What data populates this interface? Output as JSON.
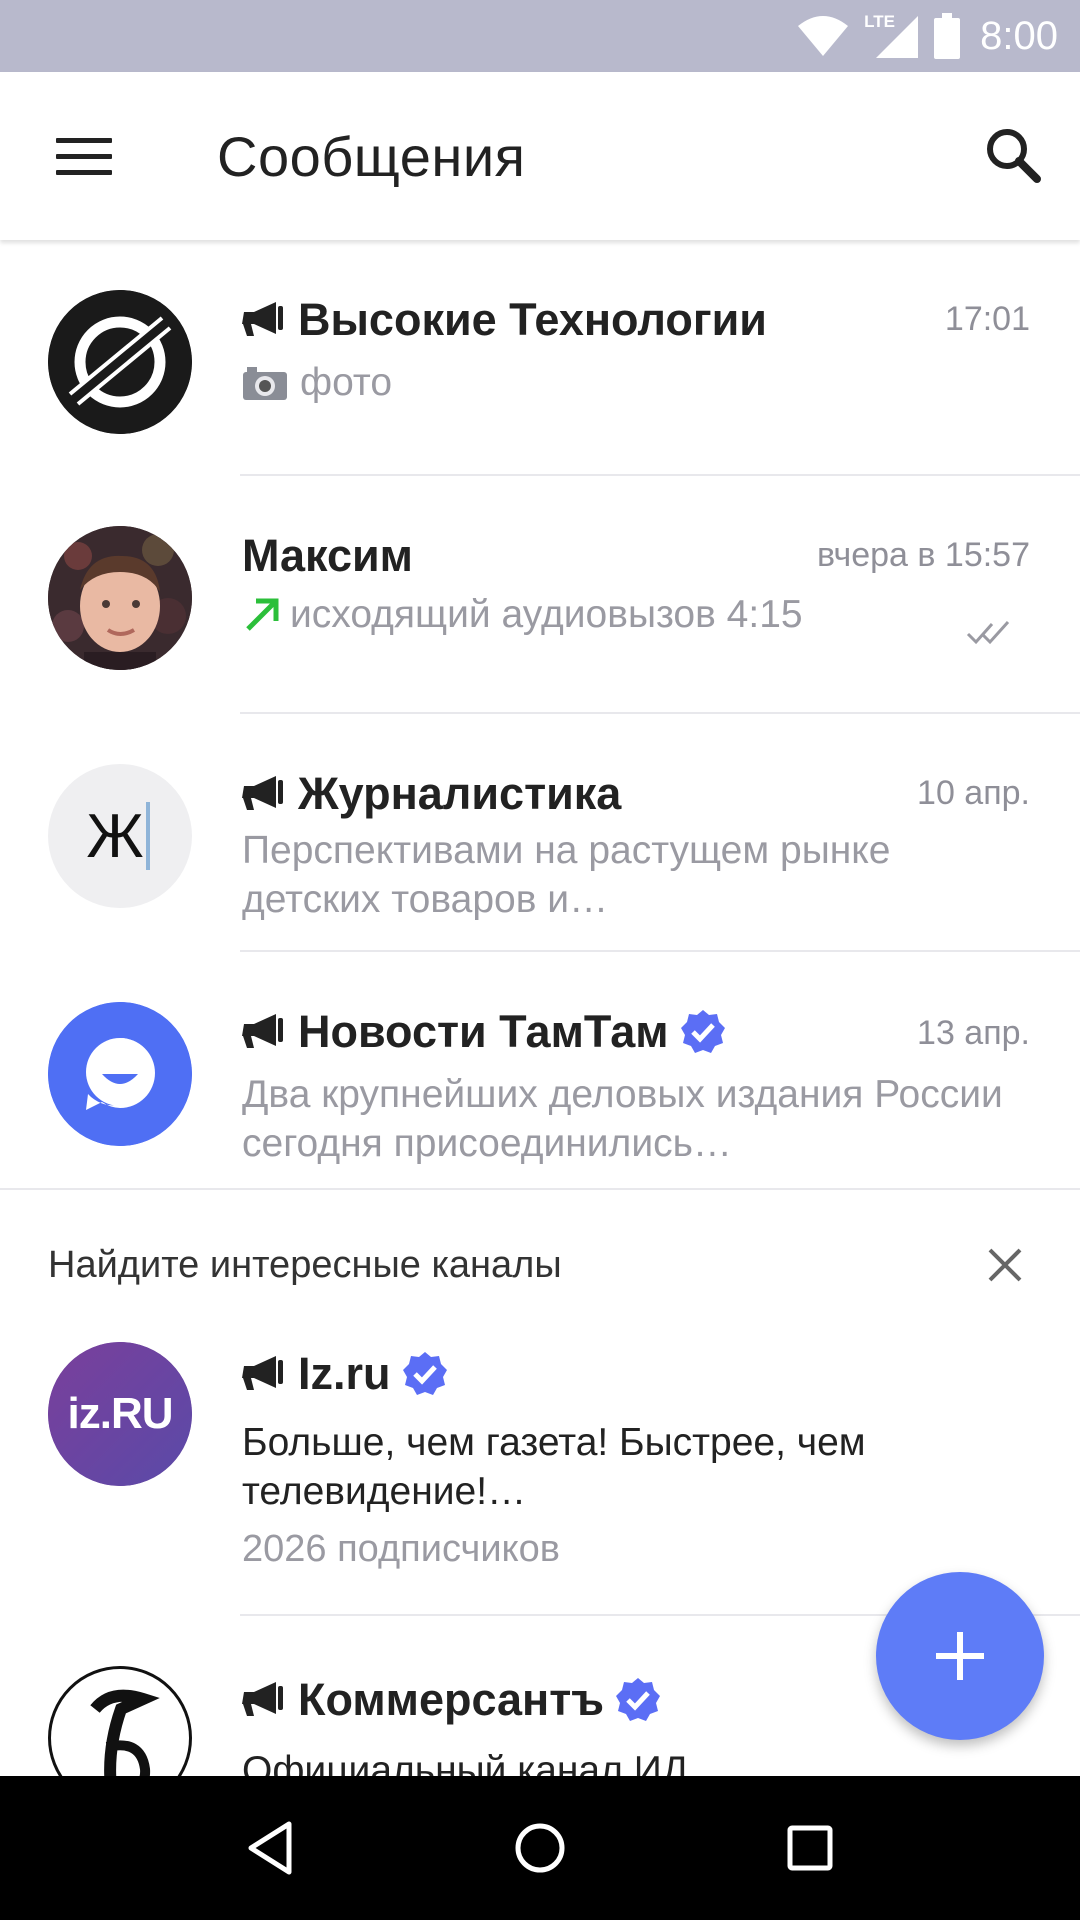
{
  "status_bar": {
    "time": "8:00",
    "network": "LTE"
  },
  "app_bar": {
    "title": "Сообщения"
  },
  "chats": [
    {
      "name": "Высокие Технологии",
      "time": "17:01",
      "preview": "фото",
      "is_channel": true
    },
    {
      "name": "Максим",
      "time": "вчера в 15:57",
      "preview": "исходящий аудиовызов 4:15",
      "is_channel": false
    },
    {
      "name": "Журналистика",
      "time": "10 апр.",
      "preview": "Перспективами на растущем рынке детских товаров и…",
      "is_channel": true,
      "avatar_letter": "Ж"
    },
    {
      "name": "Новости ТамТам",
      "time": "13 апр.",
      "preview": "Два крупнейших деловых издания России сегодня присоединились…",
      "is_channel": true,
      "verified": true
    }
  ],
  "suggestions": {
    "title": "Найдите интересные каналы",
    "channels": [
      {
        "name": "Iz.ru",
        "description": "Больше, чем газета! Быстрее, чем телевидение!…",
        "subscribers": "2026 подписчиков",
        "verified": true,
        "avatar_text": "iz.RU"
      },
      {
        "name": "Коммерсантъ",
        "description": "Официальный канал ИД",
        "verified": true
      }
    ]
  },
  "colors": {
    "accent": "#5e7cf7",
    "verified": "#5b6ef5",
    "status_bar": "#b8b9cc",
    "outgoing_call": "#2bbf3a"
  },
  "icons": [
    "menu-icon",
    "search-icon",
    "megaphone-icon",
    "camera-icon",
    "outgoing-call-arrow-icon",
    "double-check-icon",
    "verified-icon",
    "close-icon",
    "plus-icon",
    "back-icon",
    "home-icon",
    "recents-icon",
    "wifi-icon",
    "signal-icon",
    "battery-icon"
  ]
}
